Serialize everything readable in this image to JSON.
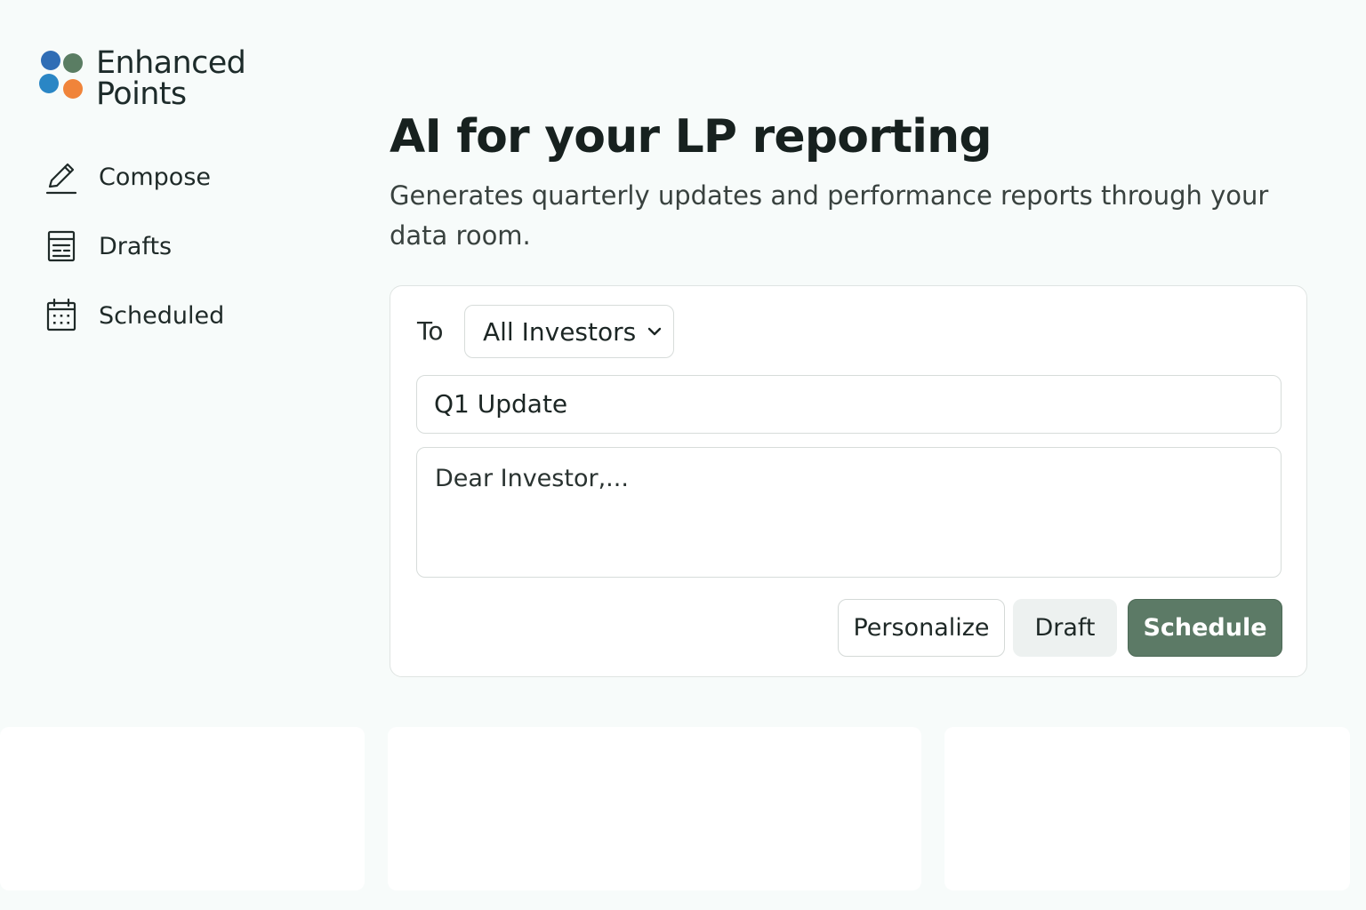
{
  "brand": {
    "name_line1": "Enhanced",
    "name_line2": "Points",
    "colors": [
      "#2f6db5",
      "#5a7d63",
      "#2a86c5",
      "#f0843a"
    ]
  },
  "sidebar": {
    "items": [
      {
        "label": "Compose",
        "icon": "pencil-icon"
      },
      {
        "label": "Drafts",
        "icon": "document-list-icon"
      },
      {
        "label": "Scheduled",
        "icon": "calendar-icon"
      }
    ]
  },
  "main": {
    "title": "AI for your LP reporting",
    "subtitle": "Generates quarterly updates and performance reports through your data room."
  },
  "composer": {
    "to_label": "To",
    "recipients_value": "All Investors",
    "subject_value": "Q1 Update",
    "body_value": "Dear Investor,...",
    "buttons": {
      "personalize": "Personalize",
      "draft": "Draft",
      "schedule": "Schedule"
    },
    "accent_color": "#5c7a66"
  }
}
